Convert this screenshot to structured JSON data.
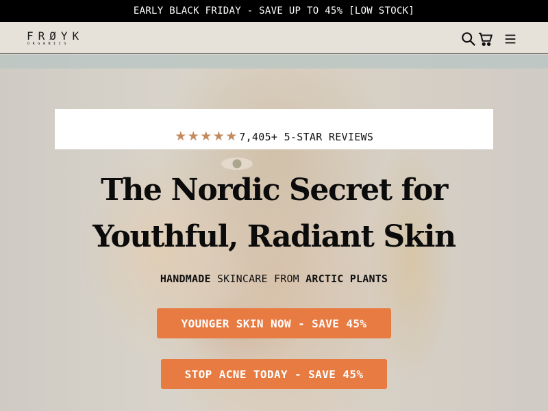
{
  "announcement": {
    "text": "EARLY BLACK FRIDAY - SAVE UP TO 45% [LOW STOCK]"
  },
  "header": {
    "logo": {
      "main": "FRØYK",
      "sub": "ORGANICS"
    },
    "icons": [
      "search-icon",
      "cart-icon",
      "menu-icon"
    ]
  },
  "hero": {
    "rating": {
      "stars": 5,
      "text": "7,405+ 5-STAR REVIEWS"
    },
    "headline": {
      "line1": "The Nordic Secret for",
      "line2": "Youthful, Radiant Skin"
    },
    "subhead": {
      "part1": "HANDMADE",
      "part2": " SKINCARE FROM ",
      "part3": "ARCTIC PLANTS"
    },
    "cta_primary": "YOUNGER SKIN NOW - SAVE 45%",
    "cta_secondary": "STOP ACNE TODAY - SAVE 45%"
  },
  "colors": {
    "accent": "#e77b41",
    "star": "#c38a5e",
    "announcement_bg": "#000000",
    "header_bg": "#e6e2da"
  }
}
